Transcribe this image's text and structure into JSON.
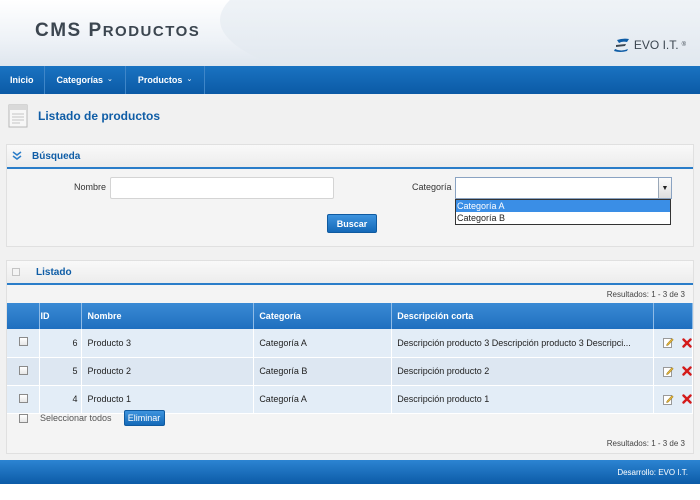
{
  "header": {
    "title_big1": "CMS",
    "title_cap": "P",
    "title_rest": "RODUCTOS",
    "logo_text": "EVO I.T.",
    "logo_sup": "®"
  },
  "nav": [
    {
      "label": "Inicio",
      "has_menu": false
    },
    {
      "label": "Categorías",
      "has_menu": true
    },
    {
      "label": "Productos",
      "has_menu": true
    }
  ],
  "page": {
    "title": "Listado de productos"
  },
  "search": {
    "title": "Búsqueda",
    "nombre_label": "Nombre",
    "nombre_value": "",
    "categoria_label": "Categoría",
    "categoria_value": "",
    "options": [
      "Categoría A",
      "Categoría B"
    ],
    "highlighted_option": "Categoría A",
    "button": "Buscar"
  },
  "list": {
    "title": "Listado",
    "results_top": "Resultados: 1 - 3 de 3",
    "results_bottom": "Resultados: 1 - 3 de 3",
    "columns": [
      "",
      "ID",
      "Nombre",
      "Categoría",
      "Descripción corta",
      ""
    ],
    "rows": [
      {
        "id": "6",
        "nombre": "Producto 3",
        "categoria": "Categoría A",
        "descripcion": "Descripción producto 3 Descripción producto 3 Descripci..."
      },
      {
        "id": "5",
        "nombre": "Producto 2",
        "categoria": "Categoría B",
        "descripcion": "Descripción producto 2"
      },
      {
        "id": "4",
        "nombre": "Producto 1",
        "categoria": "Categoría A",
        "descripcion": "Descripción producto 1"
      }
    ],
    "select_all": "Seleccionar todos",
    "delete_button": "Eliminar"
  },
  "footer": {
    "text": "Desarrollo: EVO I.T."
  },
  "colors": {
    "nav_blue": "#0b5aa6",
    "title_blue": "#0f5da6",
    "delete_red": "#d41a1a"
  }
}
